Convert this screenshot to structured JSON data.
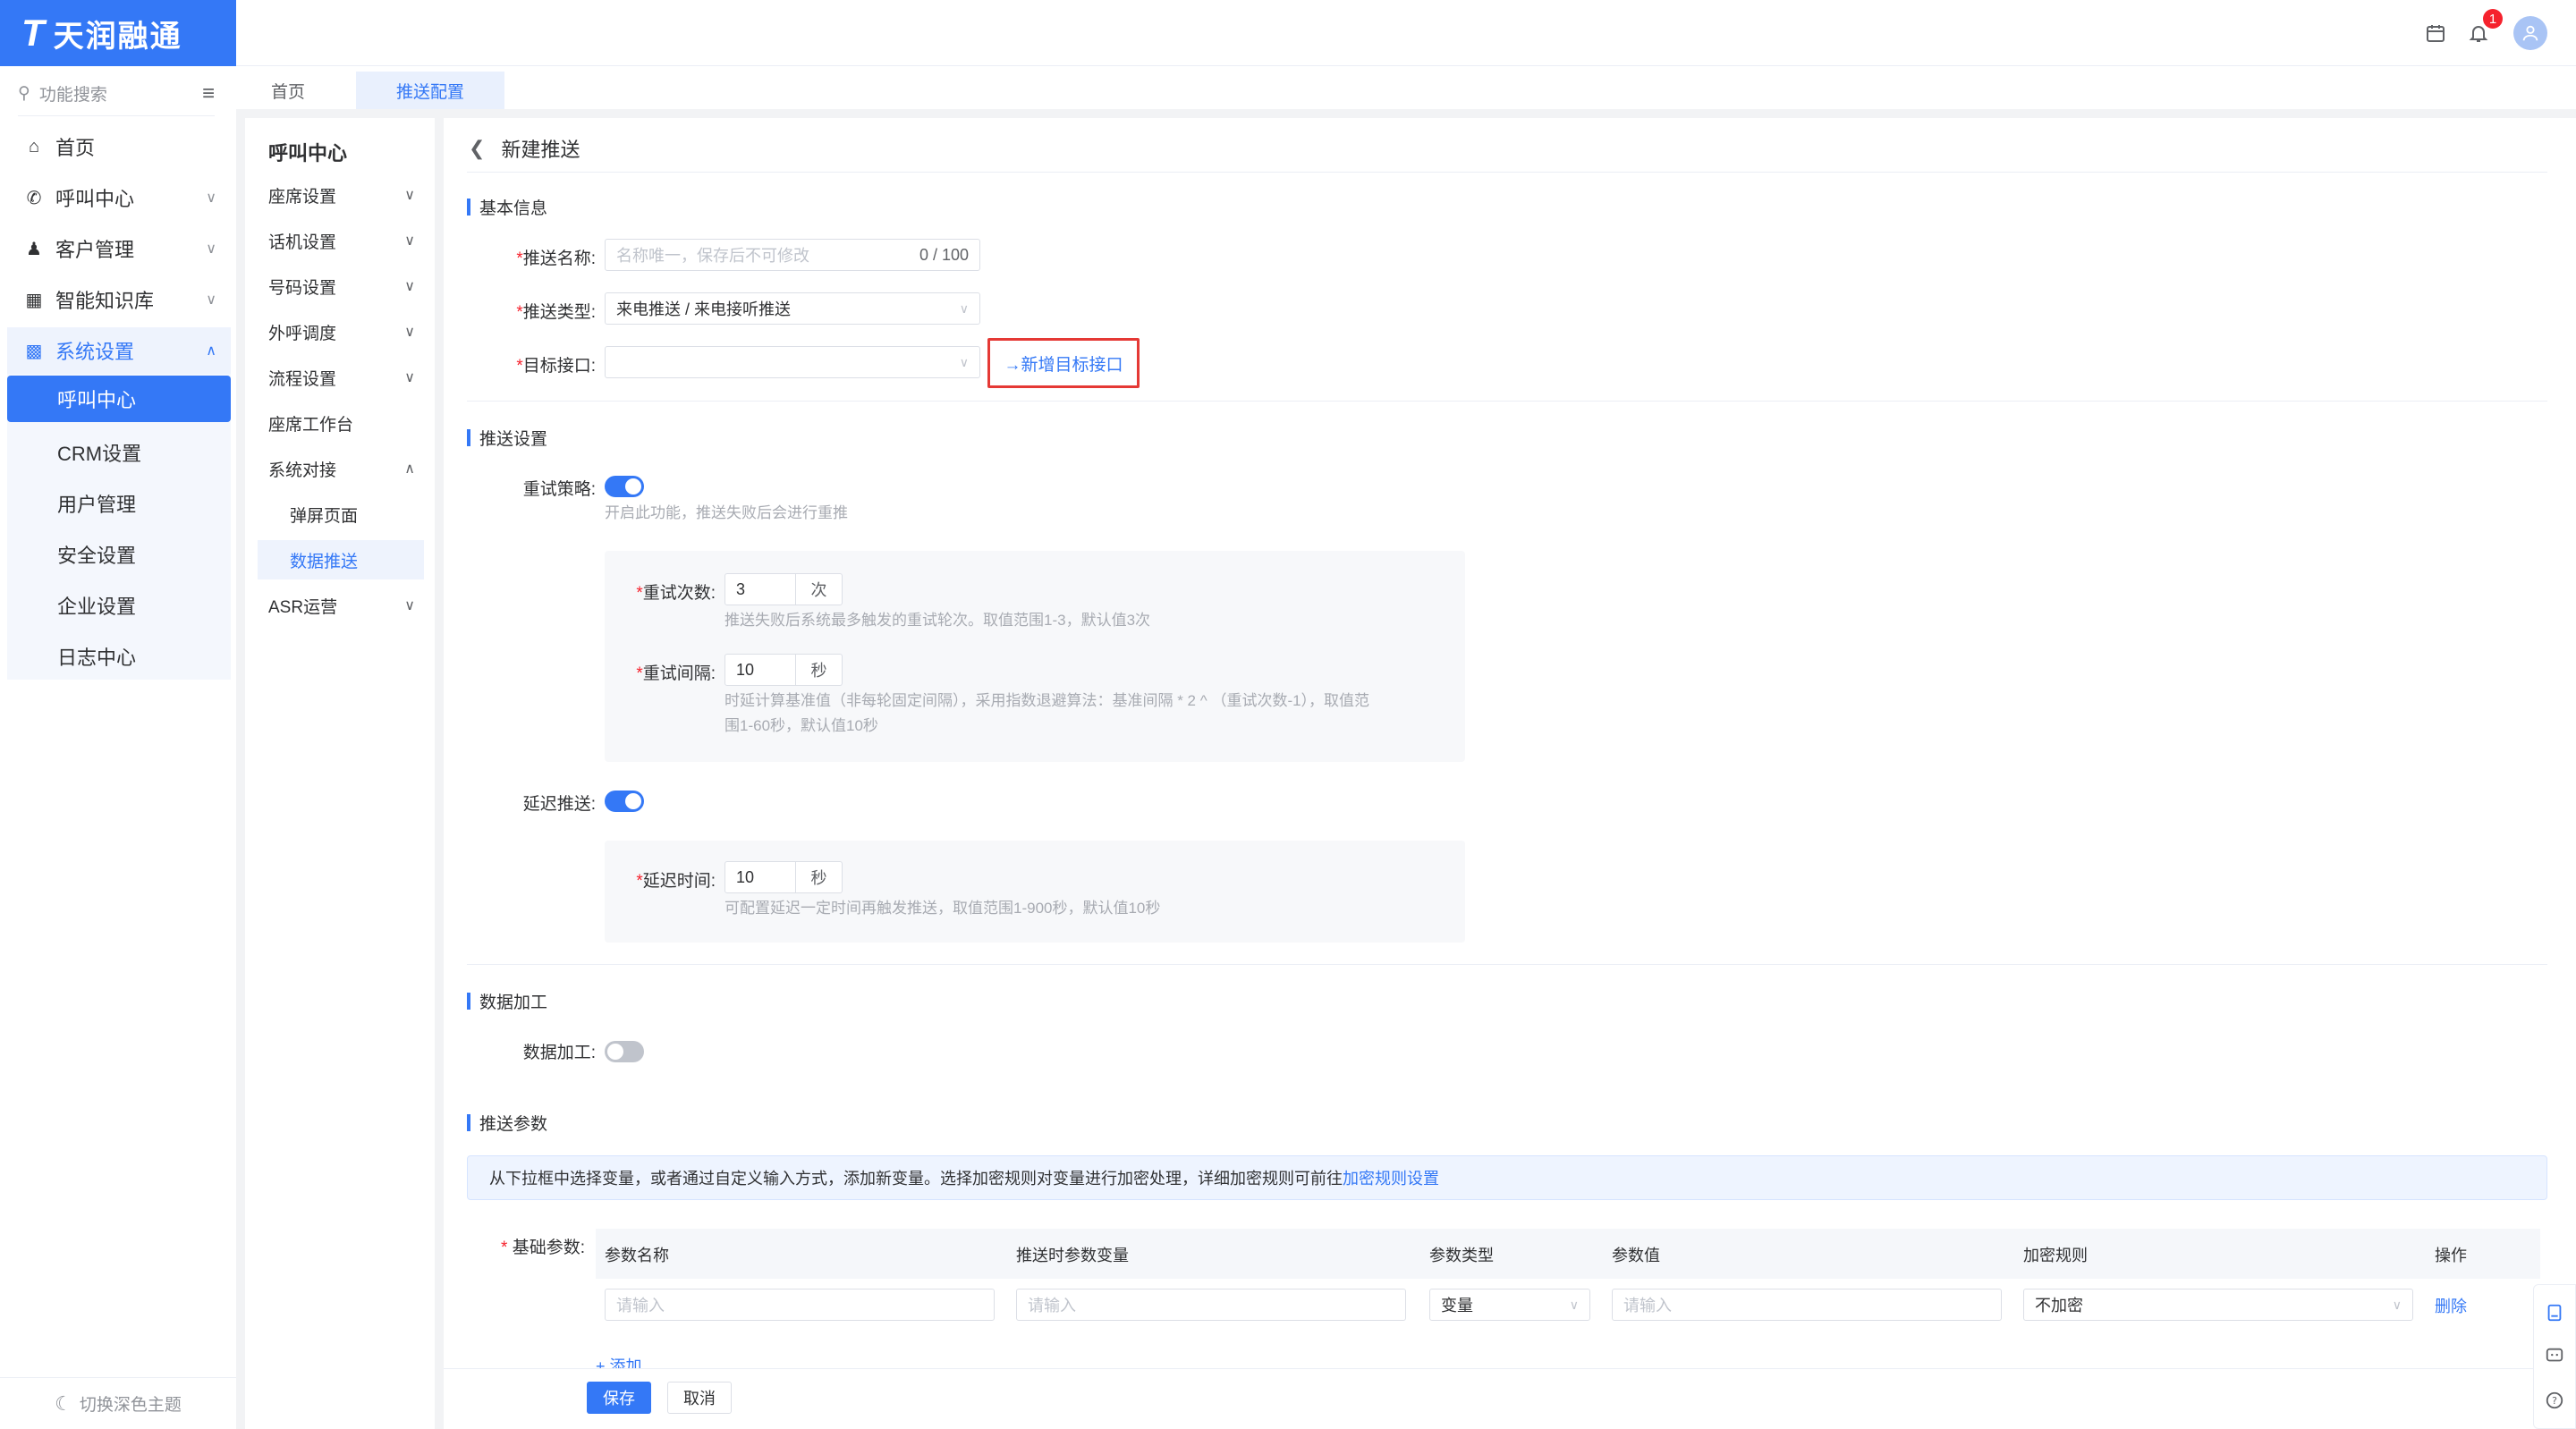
{
  "app": {
    "logo_mark": "T",
    "logo_text": "天润融通"
  },
  "topbar": {
    "notification_count": "1"
  },
  "sidebar": {
    "search_placeholder": "功能搜索",
    "items": [
      {
        "label": "首页",
        "icon": "home-icon"
      },
      {
        "label": "呼叫中心",
        "icon": "phone-icon"
      },
      {
        "label": "客户管理",
        "icon": "users-icon"
      },
      {
        "label": "智能知识库",
        "icon": "grid-icon"
      },
      {
        "label": "系统设置",
        "icon": "apps-icon"
      }
    ],
    "sub_items": [
      "呼叫中心",
      "CRM设置",
      "用户管理",
      "安全设置",
      "企业设置",
      "日志中心"
    ],
    "theme_toggle": "切换深色主题"
  },
  "tabs": [
    {
      "label": "首页"
    },
    {
      "label": "推送配置"
    }
  ],
  "submenu": {
    "title": "呼叫中心",
    "items": [
      "座席设置",
      "话机设置",
      "号码设置",
      "外呼调度",
      "流程设置",
      "座席工作台",
      "系统对接",
      "ASR运营"
    ],
    "sub_items": [
      "弹屏页面",
      "数据推送"
    ]
  },
  "page": {
    "back_title": "新建推送"
  },
  "basic": {
    "section": "基本信息",
    "name_label": "推送名称:",
    "name_placeholder": "名称唯一，保存后不可修改",
    "name_count": "0 / 100",
    "type_label": "推送类型:",
    "type_value": "来电推送 / 来电接听推送",
    "target_label": "目标接口:",
    "target_value": "",
    "new_target": "→新增目标接口"
  },
  "push": {
    "section": "推送设置",
    "retry_label": "重试策略:",
    "retry_enabled": true,
    "retry_hint": "开启此功能，推送失败后会进行重推",
    "retry_count_label": "重试次数:",
    "retry_count_value": "3",
    "retry_count_unit": "次",
    "retry_count_hint": "推送失败后系统最多触发的重试轮次。取值范围1-3，默认值3次",
    "retry_interval_label": "重试间隔:",
    "retry_interval_value": "10",
    "retry_interval_unit": "秒",
    "retry_interval_hint_1": "时延计算基准值（非每轮固定间隔），采用指数退避算法：基准间隔 * 2 ^ （重试次数-1），取值范",
    "retry_interval_hint_2": "围1-60秒，默认值10秒",
    "delay_label": "延迟推送:",
    "delay_enabled": true,
    "delay_time_label": "延迟时间:",
    "delay_time_value": "10",
    "delay_time_unit": "秒",
    "delay_time_hint": "可配置延迟一定时间再触发推送，取值范围1-900秒，默认值10秒"
  },
  "processing": {
    "section": "数据加工",
    "label": "数据加工:",
    "enabled": false
  },
  "params": {
    "section": "推送参数",
    "info": "从下拉框中选择变量，或者通过自定义输入方式，添加新变量。选择加密规则对变量进行加密处理，详细加密规则可前往",
    "info_link": "加密规则设置",
    "base_label": "基础参数:",
    "columns": [
      "参数名称",
      "推送时参数变量",
      "参数类型",
      "参数值",
      "加密规则",
      "操作"
    ],
    "row": {
      "name_placeholder": "请输入",
      "var_placeholder": "请输入",
      "type_value": "变量",
      "value_placeholder": "请输入",
      "encrypt_value": "不加密",
      "action": "删除"
    },
    "add_label": "+ 添加"
  },
  "footer": {
    "save": "保存",
    "cancel": "取消"
  },
  "colors": {
    "primary": "#3478f6",
    "danger": "#f5222d",
    "highlight_box": "#e53935"
  }
}
